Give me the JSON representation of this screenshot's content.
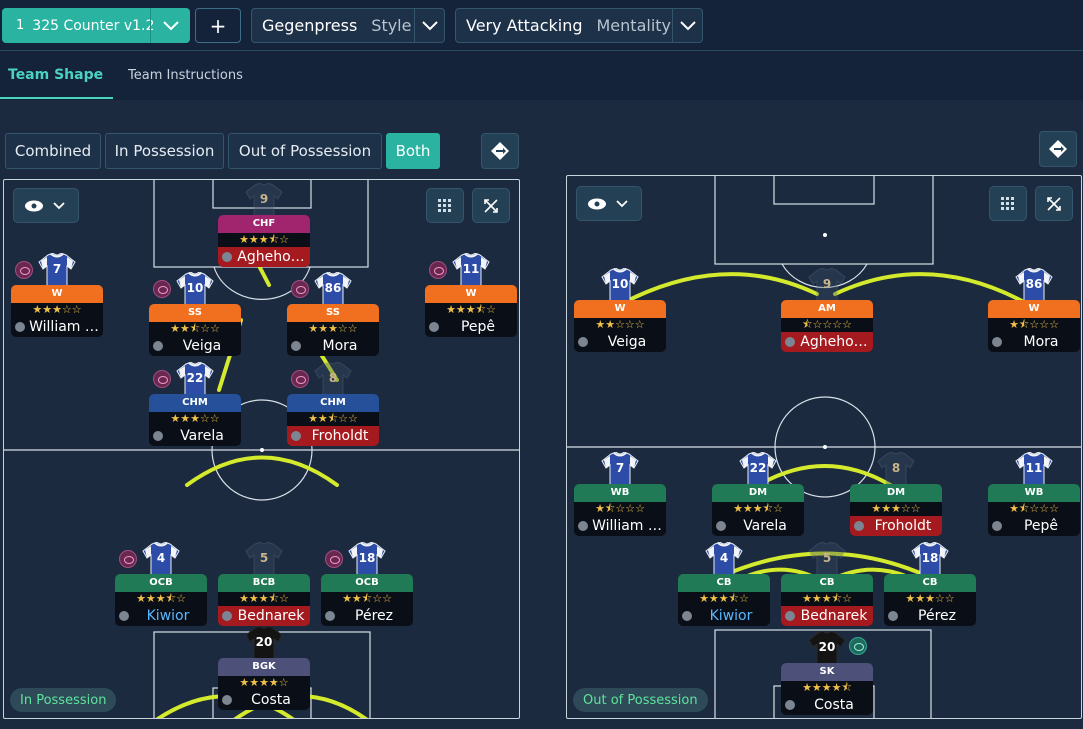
{
  "header": {
    "tactic_number": "1",
    "tactic_name": "325 Counter v1.2",
    "add_label": "+",
    "style_value": "Gegenpress",
    "style_label": "Style",
    "mentality_value": "Very Attacking",
    "mentality_label": "Mentality"
  },
  "tabs": [
    "Team Shape",
    "Team Instructions"
  ],
  "view_buttons": [
    "Combined",
    "In Possession",
    "Out of Possession",
    "Both"
  ],
  "active_view": "Both",
  "pitches": [
    {
      "label": "In Possession",
      "players": [
        {
          "num": "9",
          "role": "CHF",
          "stars": "★★★⯪☆",
          "name": "Agheho…",
          "role_color": "magenta",
          "name_style": "red",
          "jersey": "ghost",
          "badge": false
        },
        {
          "num": "7",
          "role": "W",
          "stars": "★★★☆☆",
          "name": "William …",
          "role_color": "orange",
          "name_style": "normal",
          "jersey": "blue",
          "badge": true
        },
        {
          "num": "11",
          "role": "W",
          "stars": "★★★⯪☆",
          "name": "Pepê",
          "role_color": "orange",
          "name_style": "normal",
          "jersey": "blue",
          "badge": true
        },
        {
          "num": "10",
          "role": "SS",
          "stars": "★★⯪☆☆",
          "name": "Veiga",
          "role_color": "orange",
          "name_style": "normal",
          "jersey": "blue",
          "badge": true
        },
        {
          "num": "86",
          "role": "SS",
          "stars": "★★★☆☆",
          "name": "Mora",
          "role_color": "orange",
          "name_style": "normal",
          "jersey": "blue",
          "badge": true
        },
        {
          "num": "22",
          "role": "CHM",
          "stars": "★★★☆☆",
          "name": "Varela",
          "role_color": "navy",
          "name_style": "normal",
          "jersey": "blue",
          "badge": true
        },
        {
          "num": "8",
          "role": "CHM",
          "stars": "★★⯪☆☆",
          "name": "Froholdt",
          "role_color": "navy",
          "name_style": "red",
          "jersey": "ghost",
          "badge": true
        },
        {
          "num": "4",
          "role": "OCB",
          "stars": "★★★⯪☆",
          "name": "Kiwior",
          "role_color": "green",
          "name_style": "blue",
          "jersey": "blue",
          "badge": true
        },
        {
          "num": "5",
          "role": "BCB",
          "stars": "★★★⯪☆",
          "name": "Bednarek",
          "role_color": "green",
          "name_style": "red",
          "jersey": "ghost",
          "badge": false
        },
        {
          "num": "18",
          "role": "OCB",
          "stars": "★★⯪☆☆",
          "name": "Pérez",
          "role_color": "green",
          "name_style": "normal",
          "jersey": "blue",
          "badge": true
        },
        {
          "num": "20",
          "role": "BGK",
          "stars": "★★★★☆",
          "name": "Costa",
          "role_color": "slate",
          "name_style": "normal",
          "jersey": "dark",
          "badge": false
        }
      ]
    },
    {
      "label": "Out of Possession",
      "players": [
        {
          "num": "9",
          "role": "AM",
          "stars": "⯪☆☆☆☆",
          "name": "Agheho…",
          "role_color": "orange",
          "name_style": "red",
          "jersey": "ghost",
          "badge": false
        },
        {
          "num": "10",
          "role": "W",
          "stars": "★★☆☆☆",
          "name": "Veiga",
          "role_color": "orange",
          "name_style": "normal",
          "jersey": "blue",
          "badge": false
        },
        {
          "num": "86",
          "role": "W",
          "stars": "★⯪☆☆☆",
          "name": "Mora",
          "role_color": "orange",
          "name_style": "normal",
          "jersey": "blue",
          "badge": false
        },
        {
          "num": "7",
          "role": "WB",
          "stars": "★⯪☆☆☆",
          "name": "William …",
          "role_color": "green",
          "name_style": "normal",
          "jersey": "blue",
          "badge": false
        },
        {
          "num": "22",
          "role": "DM",
          "stars": "★★★⯪☆",
          "name": "Varela",
          "role_color": "green",
          "name_style": "normal",
          "jersey": "blue",
          "badge": false
        },
        {
          "num": "8",
          "role": "DM",
          "stars": "★★★☆☆",
          "name": "Froholdt",
          "role_color": "green",
          "name_style": "red",
          "jersey": "ghost",
          "badge": false
        },
        {
          "num": "11",
          "role": "WB",
          "stars": "★⯪☆☆☆",
          "name": "Pepê",
          "role_color": "green",
          "name_style": "normal",
          "jersey": "blue",
          "badge": false
        },
        {
          "num": "4",
          "role": "CB",
          "stars": "★★★⯪☆",
          "name": "Kiwior",
          "role_color": "green",
          "name_style": "blue",
          "jersey": "blue",
          "badge": false
        },
        {
          "num": "5",
          "role": "CB",
          "stars": "★★★⯪☆",
          "name": "Bednarek",
          "role_color": "green",
          "name_style": "red",
          "jersey": "ghost",
          "badge": false
        },
        {
          "num": "18",
          "role": "CB",
          "stars": "★★★☆☆",
          "name": "Pérez",
          "role_color": "green",
          "name_style": "normal",
          "jersey": "blue",
          "badge": false
        },
        {
          "num": "20",
          "role": "SK",
          "stars": "★★★★⯪",
          "name": "Costa",
          "role_color": "slate",
          "name_style": "normal",
          "jersey": "dark",
          "badge": true
        }
      ]
    }
  ],
  "colors": {
    "accent": "#2ab3a0",
    "background": "#1b2a3f",
    "movement_arrow": "#d4ea2c"
  }
}
